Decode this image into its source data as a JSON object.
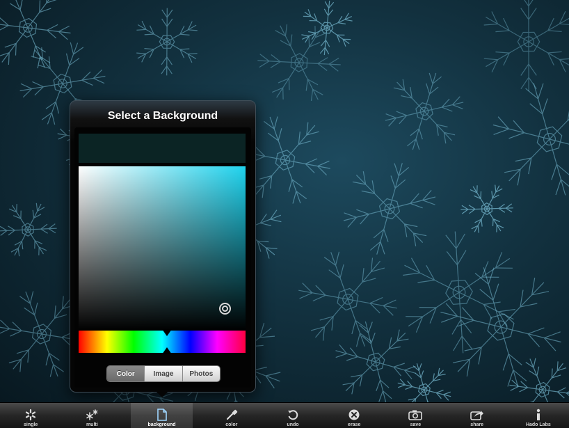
{
  "popover": {
    "title": "Select a Background",
    "selected_color": "#0b2424",
    "picker_base_hue": "#1fd3ee",
    "segments": [
      {
        "label": "Color",
        "active": true
      },
      {
        "label": "Image",
        "active": false
      },
      {
        "label": "Photos",
        "active": false
      }
    ]
  },
  "toolbar": {
    "items": [
      {
        "label": "single",
        "icon": "snowflake-icon"
      },
      {
        "label": "multi",
        "icon": "multi-snowflake-icon"
      },
      {
        "label": "background",
        "icon": "document-icon",
        "active": true
      },
      {
        "label": "color",
        "icon": "eyedropper-icon"
      },
      {
        "label": "undo",
        "icon": "undo-icon"
      },
      {
        "label": "erase",
        "icon": "erase-icon"
      },
      {
        "label": "save",
        "icon": "camera-icon"
      },
      {
        "label": "share",
        "icon": "share-icon"
      },
      {
        "label": "Hado Labs",
        "icon": "info-icon"
      }
    ]
  },
  "colors": {
    "background_tint": "#1d4a5e",
    "snowflake_stroke": "#7fc4dc"
  }
}
